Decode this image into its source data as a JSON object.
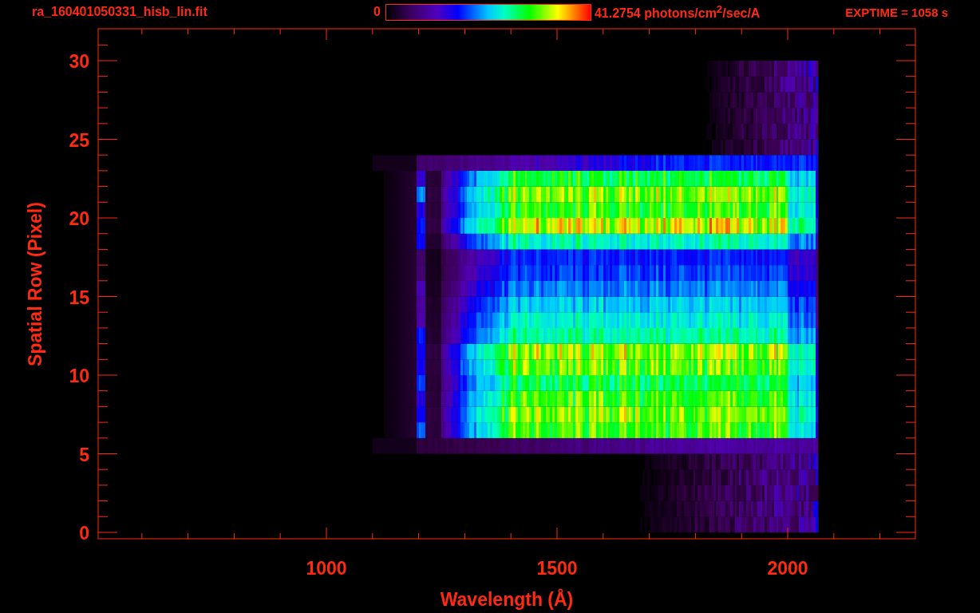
{
  "header": {
    "filename": "ra_160401050331_hisb_lin.fit",
    "colorbar": {
      "min_label": "0",
      "max_label": "41.2754 photons/cm$^{2}$/sec/A"
    },
    "exposure": "EXPTIME = 1058 s"
  },
  "plot": {
    "y_axis": {
      "label": "Spatial Row (Pixel)",
      "ticks": [
        "30",
        "25",
        "20",
        "15",
        "10",
        "5",
        "0"
      ]
    },
    "x_axis": {
      "label": "Wavelength (Å)",
      "ticks": [
        "1000",
        "1500",
        "2000"
      ]
    }
  }
}
